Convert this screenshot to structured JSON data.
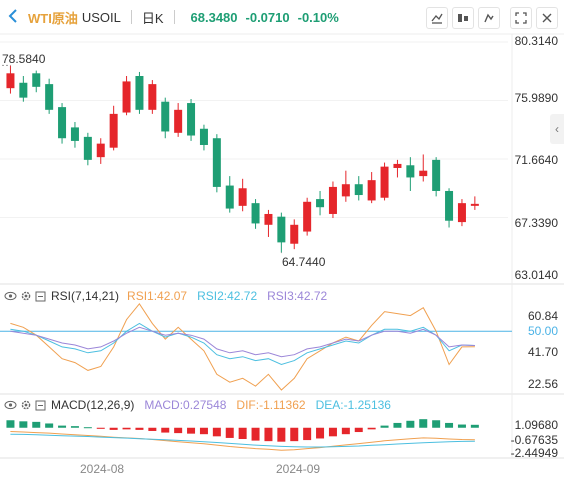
{
  "header": {
    "symbol_name": "WTI原油",
    "symbol_code": "USOIL",
    "period": "日K",
    "price": "68.3480",
    "change": "-0.0710",
    "change_pct": "-0.10%"
  },
  "colors": {
    "up": "#e5262b",
    "down": "#1e9e74",
    "rsi1": "#f0a050",
    "rsi2": "#4cbfe0",
    "rsi3": "#9b86d8",
    "macd_label": "#9b86d8",
    "dif": "#f0a050",
    "dea": "#4cbfe0",
    "ref_line": "#4cb3e6"
  },
  "chart_data": [
    {
      "type": "candlestick",
      "name": "WTI原油 日K",
      "ylim": [
        63.014,
        80.314
      ],
      "y_ticks": [
        "80.3140",
        "75.9890",
        "71.6640",
        "67.3390",
        "63.0140"
      ],
      "annotations": {
        "high": "78.5840",
        "low": "64.7440"
      },
      "x_ticks": [
        "2024-08",
        "2024-09"
      ],
      "candles": [
        {
          "o": 76.9,
          "c": 78.0,
          "h": 78.584,
          "l": 76.5
        },
        {
          "o": 77.3,
          "c": 76.2,
          "h": 77.8,
          "l": 75.9
        },
        {
          "o": 78.0,
          "c": 77.0,
          "h": 78.2,
          "l": 76.6
        },
        {
          "o": 77.2,
          "c": 75.3,
          "h": 77.6,
          "l": 75.0
        },
        {
          "o": 75.5,
          "c": 73.2,
          "h": 75.8,
          "l": 72.8
        },
        {
          "o": 74.0,
          "c": 73.0,
          "h": 74.4,
          "l": 72.5
        },
        {
          "o": 73.3,
          "c": 71.6,
          "h": 73.6,
          "l": 71.2
        },
        {
          "o": 71.8,
          "c": 72.8,
          "h": 73.2,
          "l": 71.3
        },
        {
          "o": 72.5,
          "c": 75.0,
          "h": 75.6,
          "l": 72.3
        },
        {
          "o": 75.1,
          "c": 77.4,
          "h": 77.8,
          "l": 74.9
        },
        {
          "o": 77.8,
          "c": 75.3,
          "h": 78.1,
          "l": 75.0
        },
        {
          "o": 75.3,
          "c": 77.2,
          "h": 77.5,
          "l": 75.0
        },
        {
          "o": 75.9,
          "c": 73.7,
          "h": 76.2,
          "l": 73.2
        },
        {
          "o": 73.6,
          "c": 75.3,
          "h": 75.8,
          "l": 73.3
        },
        {
          "o": 75.8,
          "c": 73.4,
          "h": 76.1,
          "l": 73.0
        },
        {
          "o": 73.9,
          "c": 72.7,
          "h": 74.2,
          "l": 72.3
        },
        {
          "o": 73.2,
          "c": 69.6,
          "h": 73.5,
          "l": 69.2
        },
        {
          "o": 69.7,
          "c": 68.0,
          "h": 70.4,
          "l": 67.7
        },
        {
          "o": 68.2,
          "c": 69.5,
          "h": 70.2,
          "l": 67.8
        },
        {
          "o": 68.4,
          "c": 66.9,
          "h": 68.7,
          "l": 66.5
        },
        {
          "o": 66.8,
          "c": 67.6,
          "h": 67.9,
          "l": 65.9
        },
        {
          "o": 67.4,
          "c": 65.5,
          "h": 67.7,
          "l": 64.744
        },
        {
          "o": 65.4,
          "c": 66.8,
          "h": 67.2,
          "l": 65.0
        },
        {
          "o": 66.3,
          "c": 68.5,
          "h": 68.8,
          "l": 66.0
        },
        {
          "o": 68.7,
          "c": 68.1,
          "h": 69.3,
          "l": 67.5
        },
        {
          "o": 67.6,
          "c": 69.6,
          "h": 70.0,
          "l": 67.3
        },
        {
          "o": 68.9,
          "c": 69.8,
          "h": 70.8,
          "l": 68.5
        },
        {
          "o": 69.8,
          "c": 69.0,
          "h": 70.4,
          "l": 68.6
        },
        {
          "o": 68.6,
          "c": 70.1,
          "h": 70.7,
          "l": 68.4
        },
        {
          "o": 68.8,
          "c": 71.1,
          "h": 71.4,
          "l": 68.6
        },
        {
          "o": 71.0,
          "c": 71.3,
          "h": 71.6,
          "l": 70.3
        },
        {
          "o": 71.2,
          "c": 70.3,
          "h": 71.8,
          "l": 69.3
        },
        {
          "o": 70.4,
          "c": 70.8,
          "h": 72.0,
          "l": 70.0
        },
        {
          "o": 71.6,
          "c": 69.3,
          "h": 71.8,
          "l": 68.9
        },
        {
          "o": 69.3,
          "c": 67.1,
          "h": 69.5,
          "l": 66.6
        },
        {
          "o": 67.0,
          "c": 68.4,
          "h": 68.7,
          "l": 66.7
        },
        {
          "o": 68.2,
          "c": 68.348,
          "h": 68.9,
          "l": 67.9
        }
      ]
    },
    {
      "type": "line",
      "name": "RSI(7,14,21)",
      "ylim": [
        22.56,
        60.84
      ],
      "y_ticks": [
        "60.84",
        "41.70",
        "22.56"
      ],
      "ref_line": {
        "value": 50.0,
        "label": "50.00"
      },
      "series": [
        {
          "name": "RSI1:42.07",
          "values": [
            54,
            52,
            48,
            42,
            36,
            34,
            30,
            32,
            42,
            56,
            64,
            54,
            46,
            52,
            46,
            40,
            28,
            24,
            26,
            22,
            28,
            20,
            26,
            36,
            40,
            44,
            47,
            45,
            53,
            60,
            59,
            58,
            62,
            50,
            33,
            42,
            42.07
          ]
        },
        {
          "name": "RSI2:42.72",
          "values": [
            51,
            50,
            48,
            45,
            42,
            41,
            39,
            40,
            44,
            50,
            54,
            50,
            47,
            49,
            47,
            44,
            38,
            36,
            37,
            35,
            36,
            33,
            35,
            39,
            41,
            43,
            45,
            44,
            48,
            51,
            51,
            50,
            52,
            48,
            40,
            43,
            42.72
          ]
        },
        {
          "name": "RSI3:42.72",
          "values": [
            50,
            49,
            48,
            46,
            44,
            43,
            41,
            42,
            45,
            49,
            52,
            50,
            48,
            49,
            48,
            46,
            41,
            39,
            40,
            38,
            39,
            37,
            38,
            41,
            42,
            44,
            46,
            45,
            48,
            50,
            50,
            49,
            51,
            48,
            42,
            43,
            42.72
          ]
        }
      ]
    },
    {
      "type": "bar",
      "name": "MACD(12,26,9)",
      "ylim": [
        -2.44949,
        1.0968
      ],
      "y_ticks": [
        "1.09680",
        "-0.67635",
        "-2.44949"
      ],
      "macd": [
        0.7,
        0.6,
        0.55,
        0.4,
        0.2,
        0.15,
        0.05,
        -0.1,
        -0.2,
        -0.15,
        -0.2,
        -0.3,
        -0.45,
        -0.5,
        -0.55,
        -0.6,
        -0.8,
        -0.95,
        -1.05,
        -1.2,
        -1.25,
        -1.3,
        -1.25,
        -1.15,
        -1.0,
        -0.8,
        -0.6,
        -0.4,
        -0.15,
        0.2,
        0.45,
        0.65,
        0.8,
        0.7,
        0.45,
        0.3,
        0.27548
      ],
      "series": [
        {
          "name": "DIF:-1.11362",
          "values": [
            -0.35,
            -0.4,
            -0.45,
            -0.5,
            -0.58,
            -0.65,
            -0.72,
            -0.8,
            -0.88,
            -0.95,
            -1.0,
            -1.1,
            -1.2,
            -1.3,
            -1.4,
            -1.5,
            -1.62,
            -1.75,
            -1.85,
            -1.95,
            -2.0,
            -2.1,
            -2.05,
            -1.95,
            -1.85,
            -1.72,
            -1.6,
            -1.48,
            -1.35,
            -1.22,
            -1.12,
            -1.02,
            -0.95,
            -0.98,
            -1.05,
            -1.1,
            -1.11362
          ]
        },
        {
          "name": "DEA:-1.25136",
          "values": [
            -0.6,
            -0.62,
            -0.65,
            -0.7,
            -0.74,
            -0.78,
            -0.82,
            -0.87,
            -0.92,
            -0.97,
            -1.02,
            -1.07,
            -1.12,
            -1.18,
            -1.24,
            -1.3,
            -1.38,
            -1.46,
            -1.54,
            -1.62,
            -1.68,
            -1.74,
            -1.78,
            -1.8,
            -1.8,
            -1.78,
            -1.74,
            -1.7,
            -1.64,
            -1.58,
            -1.52,
            -1.46,
            -1.4,
            -1.35,
            -1.3,
            -1.27,
            -1.25136
          ]
        }
      ]
    }
  ],
  "rsi_header": {
    "title": "RSI(7,14,21)",
    "rsi1": "RSI1:42.07",
    "rsi2": "RSI2:42.72",
    "rsi3": "RSI3:42.72"
  },
  "macd_header": {
    "title": "MACD(12,26,9)",
    "macd": "MACD:0.27548",
    "dif": "DIF:-1.11362",
    "dea": "DEA:-1.25136"
  },
  "icons": [
    "chevron-left-icon",
    "eye-icon",
    "gear-icon",
    "expand-icon",
    "close-icon",
    "collapse-arrow-icon"
  ]
}
